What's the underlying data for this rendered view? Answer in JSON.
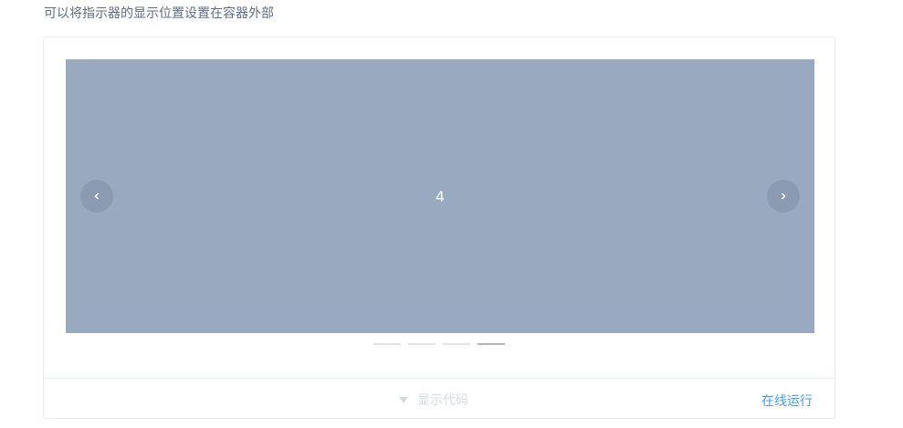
{
  "description": "可以将指示器的显示位置设置在容器外部",
  "carousel": {
    "current_slide_label": "4",
    "indicator_count": 4,
    "active_index": 3,
    "background_color": "#99a9bf",
    "prev_icon": "chevron-left-icon",
    "next_icon": "chevron-right-icon"
  },
  "controls": {
    "toggle_label": "显示代码",
    "toggle_icon": "caret-down-icon",
    "run_online_label": "在线运行"
  },
  "colors": {
    "link": "#409eff",
    "muted": "#d3dce6"
  }
}
